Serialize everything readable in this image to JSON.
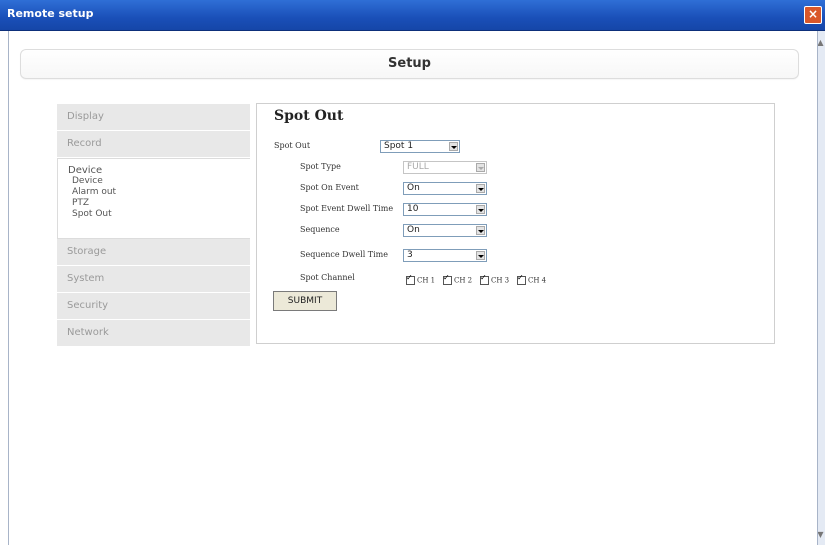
{
  "window": {
    "title": "Remote setup",
    "close_icon": "close-icon"
  },
  "header": {
    "title": "Setup"
  },
  "menu": {
    "items": [
      "Display",
      "Record",
      "Device",
      "Storage",
      "System",
      "Security",
      "Network"
    ],
    "device_subitems": [
      "Device",
      "Alarm out",
      "PTZ",
      "Spot Out"
    ]
  },
  "panel": {
    "heading": "Spot Out",
    "spot_out": {
      "label": "Spot Out",
      "value": "Spot 1"
    },
    "spot_type": {
      "label": "Spot Type",
      "value": "FULL"
    },
    "spot_on_event": {
      "label": "Spot On Event",
      "value": "On"
    },
    "spot_event_dwell_time": {
      "label": "Spot Event Dwell Time",
      "value": "10"
    },
    "sequence": {
      "label": "Sequence",
      "value": "On"
    },
    "sequence_dwell_time": {
      "label": "Sequence Dwell Time",
      "value": "3"
    },
    "spot_channel": {
      "label": "Spot Channel",
      "channels": [
        "CH 1",
        "CH 2",
        "CH 3",
        "CH 4"
      ]
    },
    "submit_label": "SUBMIT"
  }
}
